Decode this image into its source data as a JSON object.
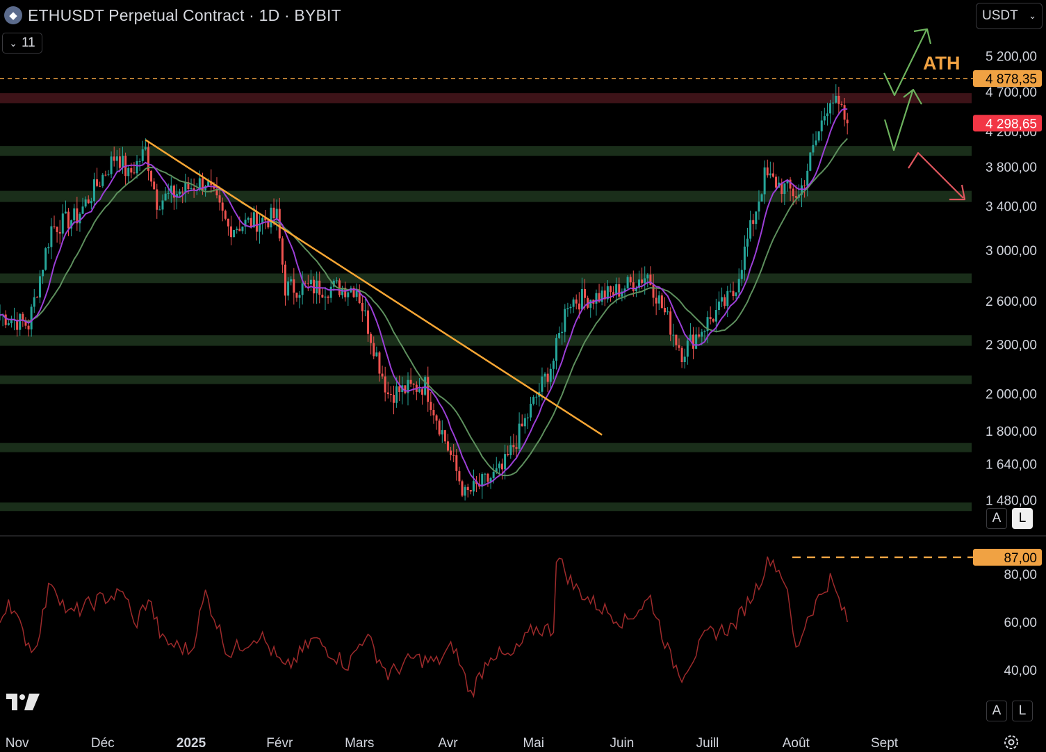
{
  "header": {
    "title": "ETHUSDT Perpetual Contract · 1D · BYBIT",
    "indicator_count": "11",
    "currency": "USDT"
  },
  "scale_buttons": {
    "auto": "A",
    "log": "L"
  },
  "chart_data": {
    "type": "line",
    "title": "ETHUSDT Perpetual Contract · 1D · BYBIT",
    "scale": "log",
    "y_ticks": [
      {
        "value": 5200,
        "label": "5 200,00"
      },
      {
        "value": 4700,
        "label": "4 700,00"
      },
      {
        "value": 4200,
        "label": "4 200,00"
      },
      {
        "value": 3800,
        "label": "3 800,00"
      },
      {
        "value": 3400,
        "label": "3 400,00"
      },
      {
        "value": 3000,
        "label": "3 000,00"
      },
      {
        "value": 2600,
        "label": "2 600,00"
      },
      {
        "value": 2300,
        "label": "2 300,00"
      },
      {
        "value": 2000,
        "label": "2 000,00"
      },
      {
        "value": 1800,
        "label": "1 800,00"
      },
      {
        "value": 1640,
        "label": "1 640,00"
      },
      {
        "value": 1480,
        "label": "1 480,00"
      }
    ],
    "x_labels": [
      "Nov",
      "Déc",
      "2025",
      "Févr",
      "Mars",
      "Avr",
      "Mai",
      "Juin",
      "Juill",
      "Août",
      "Sept"
    ],
    "price_anchors": {
      "dates": [
        "2024-10-26",
        "2024-11-05",
        "2024-11-13",
        "2024-11-22",
        "2024-12-06",
        "2024-12-10",
        "2024-12-16",
        "2024-12-20",
        "2025-01-06",
        "2025-01-14",
        "2025-01-31",
        "2025-02-03",
        "2025-02-15",
        "2025-02-28",
        "2025-03-11",
        "2025-03-24",
        "2025-04-07",
        "2025-04-20",
        "2025-05-08",
        "2025-05-13",
        "2025-05-28",
        "2025-06-10",
        "2025-06-22",
        "2025-07-01",
        "2025-07-10",
        "2025-07-21",
        "2025-08-02",
        "2025-08-13",
        "2025-08-19"
      ],
      "close": [
        2500,
        2430,
        3200,
        3300,
        3950,
        3700,
        3980,
        3450,
        3650,
        3200,
        3300,
        2700,
        2700,
        2700,
        2000,
        2050,
        1500,
        1610,
        2200,
        2600,
        2650,
        2800,
        2250,
        2450,
        2650,
        3700,
        3500,
        4650,
        4298.65
      ]
    },
    "level_lines": [
      {
        "label": "4 878,35",
        "value": 4878.35,
        "style": "dashed",
        "color": "#f0a243",
        "note": "ATH"
      },
      {
        "label": "4 298,65",
        "value": 4298.65,
        "style": "last-price",
        "color": "#f23645"
      }
    ],
    "zones": [
      {
        "type": "resistance",
        "low": 4550,
        "high": 4680,
        "color": "#3d1318"
      },
      {
        "type": "support",
        "low": 3920,
        "high": 4030,
        "color": "#1a2e1a"
      },
      {
        "type": "support",
        "low": 3440,
        "high": 3550,
        "color": "#1a2e1a"
      },
      {
        "type": "support",
        "low": 2735,
        "high": 2810,
        "color": "#1a2e1a"
      },
      {
        "type": "support",
        "low": 2290,
        "high": 2360,
        "color": "#1a2e1a"
      },
      {
        "type": "support",
        "low": 2055,
        "high": 2105,
        "color": "#1a2e1a"
      },
      {
        "type": "support",
        "low": 1695,
        "high": 1740,
        "color": "#1a2e1a"
      },
      {
        "type": "support",
        "low": 1435,
        "high": 1470,
        "color": "#1a2e1a"
      }
    ],
    "trendline": {
      "from": {
        "date": "2024-12-16",
        "value": 4100
      },
      "to": {
        "date": "2025-05-25",
        "value": 1780
      },
      "color": "#f7a634"
    },
    "annotation": {
      "text": "ATH",
      "color": "#f0a243"
    },
    "projection_arrows": [
      {
        "color": "#6db35e",
        "direction": "up"
      },
      {
        "color": "#6db35e",
        "direction": "up"
      },
      {
        "color": "#e0565e",
        "direction": "down"
      }
    ],
    "ma_colors": {
      "fast": "#9c3fd8",
      "slow": "#5d8f5d"
    },
    "candle_colors": {
      "up": "#26a69a",
      "down": "#ef5350"
    },
    "oscillator": {
      "y_ticks": [
        {
          "value": 80,
          "label": "80,00"
        },
        {
          "value": 60,
          "label": "60,00"
        },
        {
          "value": 40,
          "label": "40,00"
        }
      ],
      "level": {
        "value": 87,
        "label": "87,00",
        "color": "#f0a243"
      },
      "line_color": "#9e2a2b",
      "anchors": {
        "dates": [
          "2024-10-26",
          "2024-10-29",
          "2024-11-03",
          "2024-11-07",
          "2024-11-13",
          "2024-11-19",
          "2024-12-01",
          "2024-12-09",
          "2024-12-12",
          "2024-12-17",
          "2024-12-22",
          "2025-01-01",
          "2025-01-06",
          "2025-01-14",
          "2025-01-25",
          "2025-02-03",
          "2025-02-13",
          "2025-02-25",
          "2025-03-03",
          "2025-03-11",
          "2025-03-20",
          "2025-03-28",
          "2025-04-03",
          "2025-04-09",
          "2025-04-16",
          "2025-04-23",
          "2025-05-01",
          "2025-05-08",
          "2025-05-09",
          "2025-05-15",
          "2025-05-22",
          "2025-06-02",
          "2025-06-11",
          "2025-06-18",
          "2025-06-22",
          "2025-07-01",
          "2025-07-10",
          "2025-07-18",
          "2025-07-23",
          "2025-07-28",
          "2025-08-01",
          "2025-08-05",
          "2025-08-13",
          "2025-08-19"
        ],
        "values": [
          60,
          70,
          55,
          48,
          78,
          63,
          70,
          72,
          58,
          70,
          52,
          48,
          72,
          47,
          55,
          40,
          53,
          42,
          55,
          38,
          45,
          43,
          50,
          30,
          47,
          45,
          57,
          57,
          88,
          75,
          68,
          60,
          70,
          45,
          38,
          55,
          58,
          74,
          87,
          78,
          48,
          62,
          78,
          60
        ]
      }
    }
  }
}
